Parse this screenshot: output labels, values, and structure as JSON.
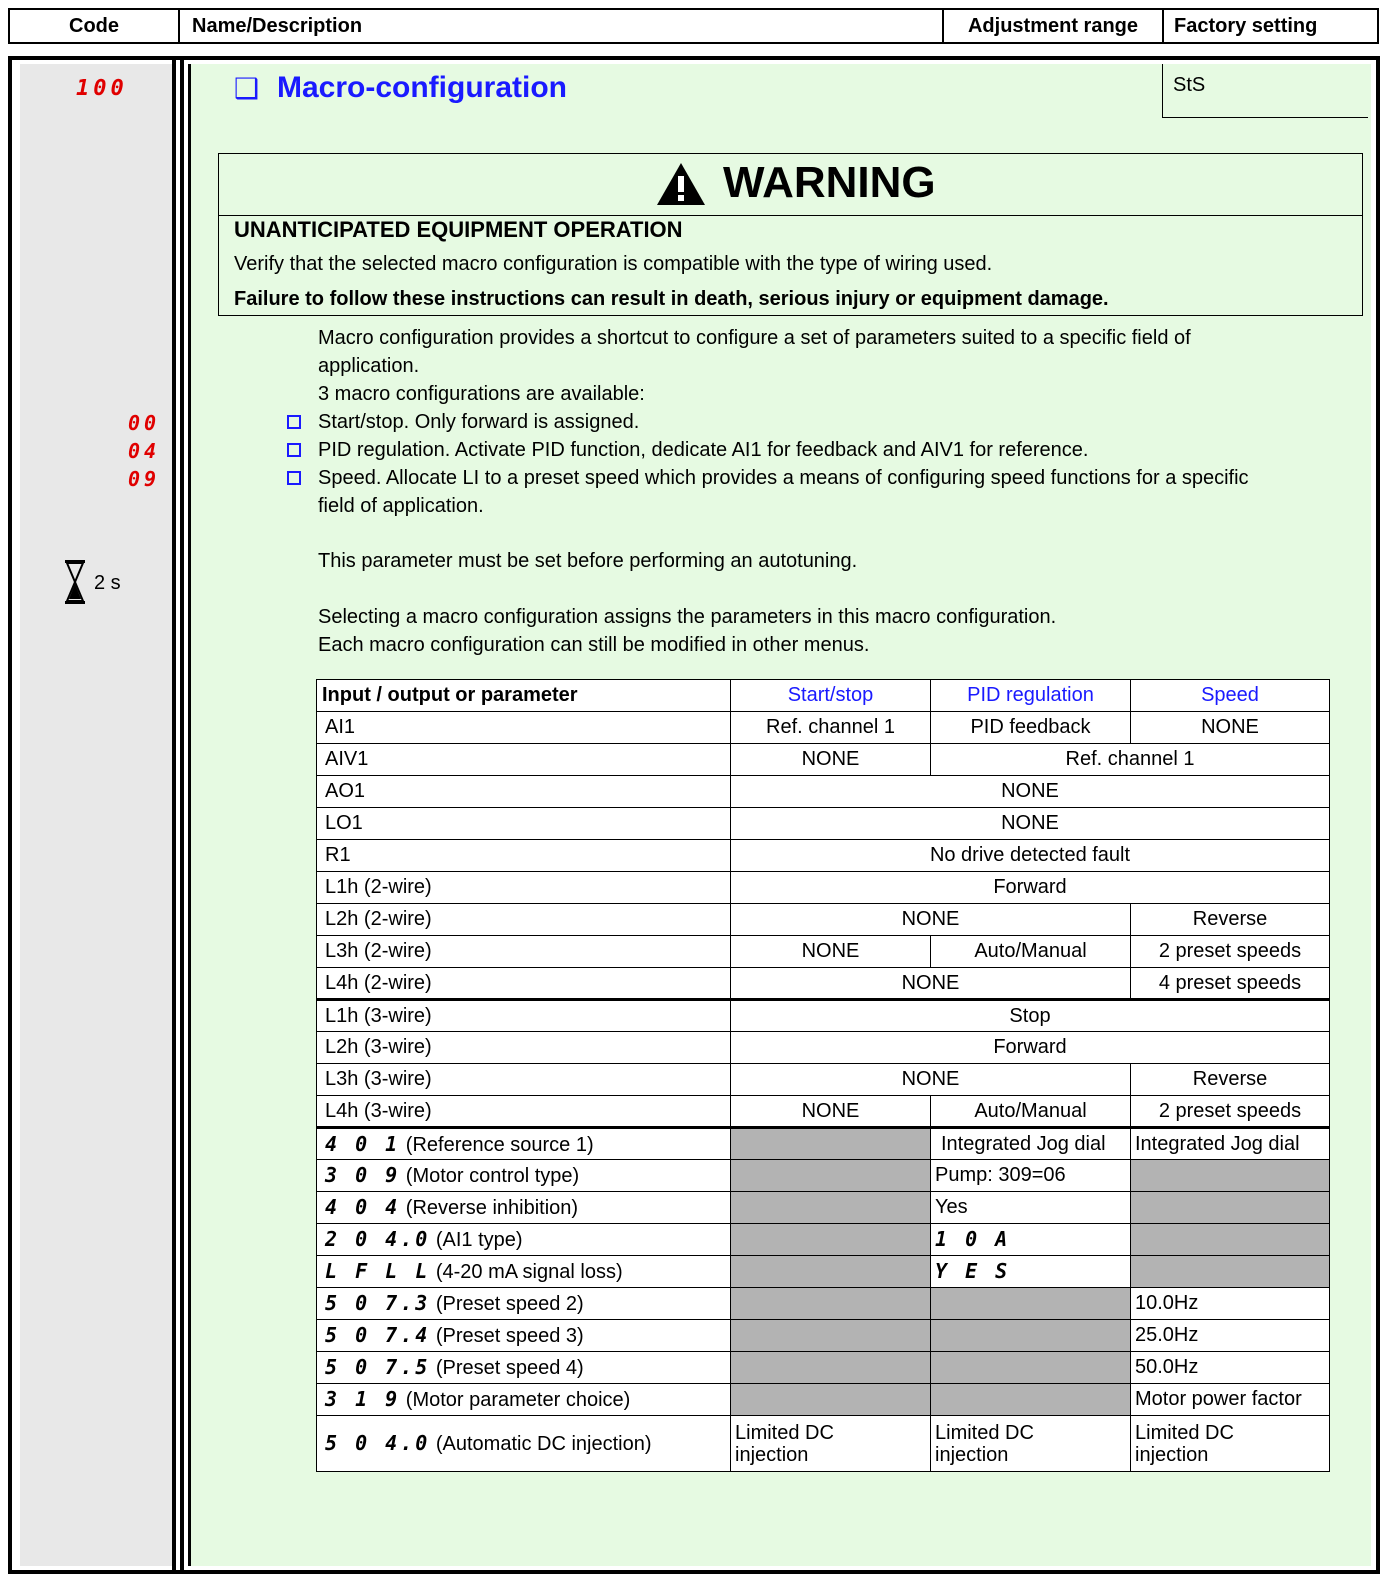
{
  "header": {
    "code": "Code",
    "name": "Name/Description",
    "range": "Adjustment range",
    "factory": "Factory setting"
  },
  "param": {
    "code": "100",
    "title": "Macro-configuration",
    "factory_value": "StS",
    "checkbox_icon": "❑",
    "opt_codes": [
      "00",
      "04",
      "09"
    ],
    "hourglass_label": "2 s"
  },
  "warning": {
    "title": "WARNING",
    "heading": "UNANTICIPATED EQUIPMENT OPERATION",
    "line1": "Verify that the selected macro configuration is compatible with the type of wiring used.",
    "line2": "Failure to follow these instructions can result in death, serious injury or equipment damage."
  },
  "description": {
    "intro1": "Macro configuration provides a shortcut to configure a set of parameters suited to a specific field of",
    "intro2": "application.",
    "intro3": "3 macro configurations are available:",
    "opt1": "Start/stop. Only forward is assigned.",
    "opt2": "PID regulation. Activate PID function, dedicate AI1 for feedback and AIV1 for reference.",
    "opt3a": "Speed. Allocate LI to a preset speed which provides a means of configuring speed functions for a specific",
    "opt3b": "field of application.",
    "note1": "This parameter must be set before performing an autotuning.",
    "note2": "Selecting a macro configuration assigns the parameters in this macro configuration.",
    "note3": "Each macro configuration can still be modified in other menus."
  },
  "table": {
    "head": [
      "Input / output or parameter",
      "Start/stop",
      "PID regulation",
      "Speed"
    ],
    "r_ai1": [
      "AI1",
      "Ref. channel 1",
      "PID feedback",
      "NONE"
    ],
    "r_aiv1": [
      "AIV1",
      "NONE",
      "Ref. channel 1"
    ],
    "r_ao1": [
      "AO1",
      "NONE"
    ],
    "r_lo1": [
      "LO1",
      "NONE"
    ],
    "r_r1": [
      "R1",
      "No drive detected fault"
    ],
    "r_l1h2": [
      "L1h (2-wire)",
      "Forward"
    ],
    "r_l2h2": [
      "L2h (2-wire)",
      "NONE",
      "Reverse"
    ],
    "r_l3h2": [
      "L3h (2-wire)",
      "NONE",
      "Auto/Manual",
      "2 preset speeds"
    ],
    "r_l4h2": [
      "L4h (2-wire)",
      "NONE",
      "4 preset speeds"
    ],
    "r_l1h3": [
      "L1h (3-wire)",
      "Stop"
    ],
    "r_l2h3": [
      "L2h (3-wire)",
      "Forward"
    ],
    "r_l3h3": [
      "L3h (3-wire)",
      "NONE",
      "Reverse"
    ],
    "r_l4h3": [
      "L4h (3-wire)",
      "NONE",
      "Auto/Manual",
      "2 preset speeds"
    ],
    "p401": [
      "4 0  1",
      "(Reference source 1)",
      "Integrated Jog dial",
      "Integrated Jog dial"
    ],
    "p309": [
      "3 0 9",
      "(Motor control type)",
      "Pump: 309=06"
    ],
    "p404": [
      "4 0 4",
      "(Reverse inhibition)",
      "Yes"
    ],
    "p2040": [
      "2 0 4.0",
      "(AI1 type)",
      "1 0 A"
    ],
    "plfll": [
      "L F L L",
      "(4-20 mA signal loss)",
      "Y E S"
    ],
    "p5073": [
      "5 0 7.3",
      "(Preset speed 2)",
      "10.0Hz"
    ],
    "p5074": [
      "5 0 7.4",
      "(Preset speed 3)",
      "25.0Hz"
    ],
    "p5075": [
      "5 0 7.5",
      "(Preset speed 4)",
      "50.0Hz"
    ],
    "p319": [
      "3  1 9",
      "(Motor parameter choice)",
      "Motor power factor"
    ],
    "p5040": [
      "5 0 4.0",
      "(Automatic DC injection)",
      "Limited DC",
      "injection"
    ]
  },
  "colors": {
    "accent_blue": "#1a1aff",
    "code_red": "#e00000",
    "panel_green": "#e6fae2",
    "code_col_grey": "#e8e8e8",
    "cell_grey": "#b3b3b3"
  }
}
